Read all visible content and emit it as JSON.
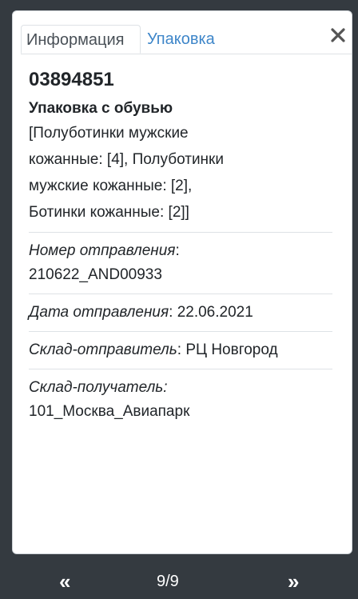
{
  "tabs": {
    "info_label": "Информация",
    "package_label": "Упаковка"
  },
  "item": {
    "code": "03894851",
    "name": "Упаковка с обувью",
    "contents": "[Полуботинки мужские кожанные: [4], Полуботинки мужские кожанные: [2], Ботинки кожанные: [2]]",
    "shipment_number_label": "Номер отправления",
    "shipment_number_value": "210622_AND00933",
    "shipment_date_label": "Дата отправления",
    "shipment_date_value": "22.06.2021",
    "sender_label": "Склад-отправитель",
    "sender_value": "РЦ Новгород",
    "receiver_label": "Склад-получатель:",
    "receiver_value": "101_Москва_Авиапарк"
  },
  "footer": {
    "prev_label": "«",
    "pager": "9/9",
    "next_label": "»"
  },
  "icons": {
    "close": "close-icon"
  }
}
